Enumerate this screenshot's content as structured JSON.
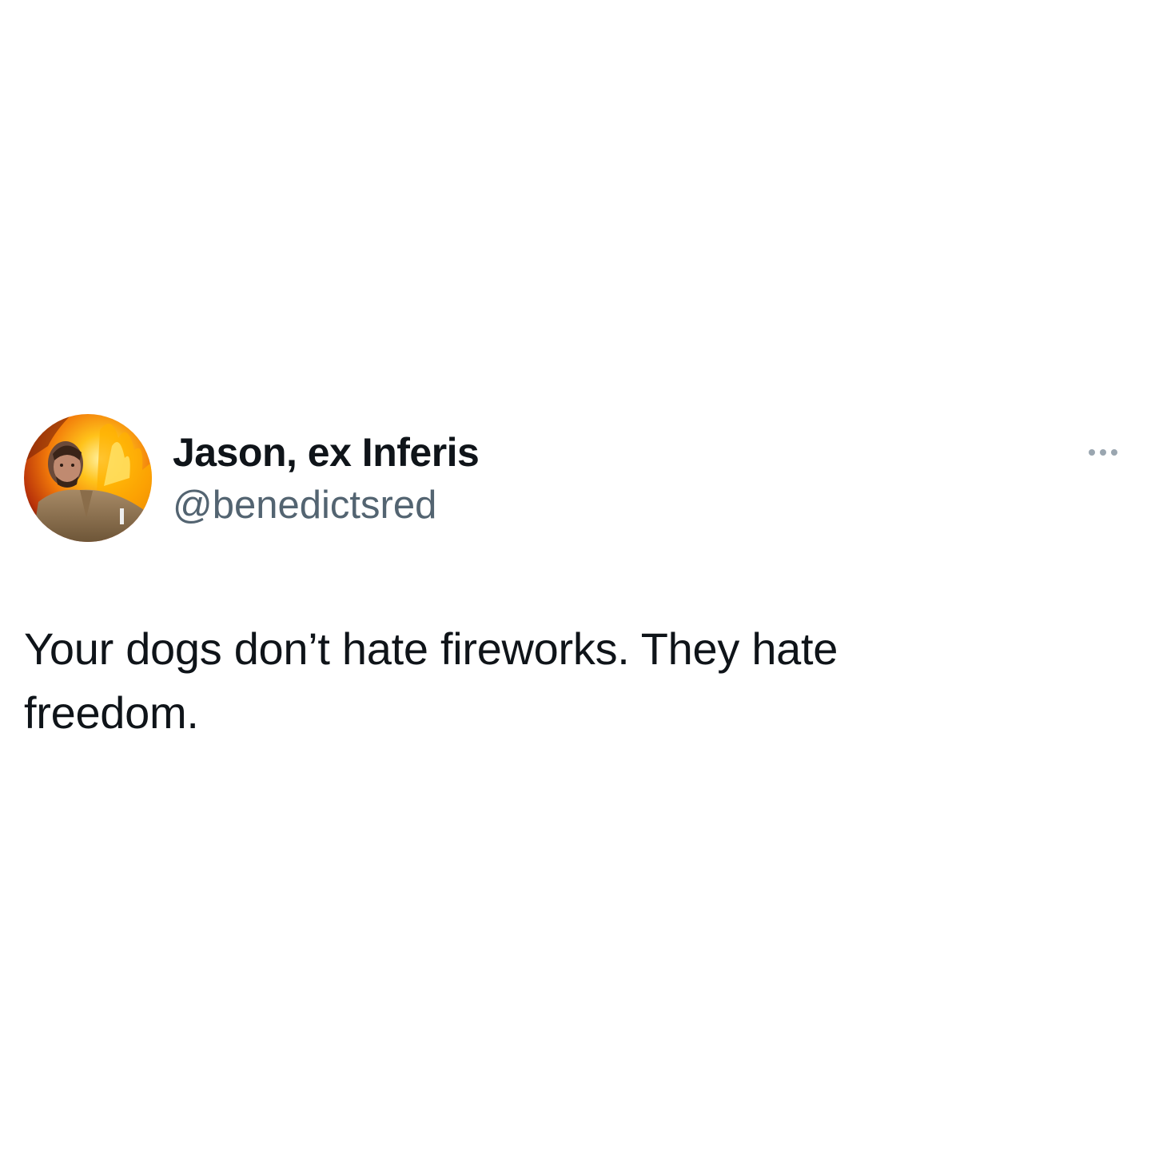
{
  "tweet": {
    "author": {
      "display_name": "Jason, ex Inferis",
      "handle": "@benedictsred",
      "avatar_icon": "profile-photo-fire-background"
    },
    "more_icon": "more-options-icon",
    "text": "Your dogs don’t hate fireworks. They hate freedom."
  },
  "colors": {
    "text_primary": "#0f1419",
    "text_secondary": "#536471",
    "background": "#ffffff"
  }
}
